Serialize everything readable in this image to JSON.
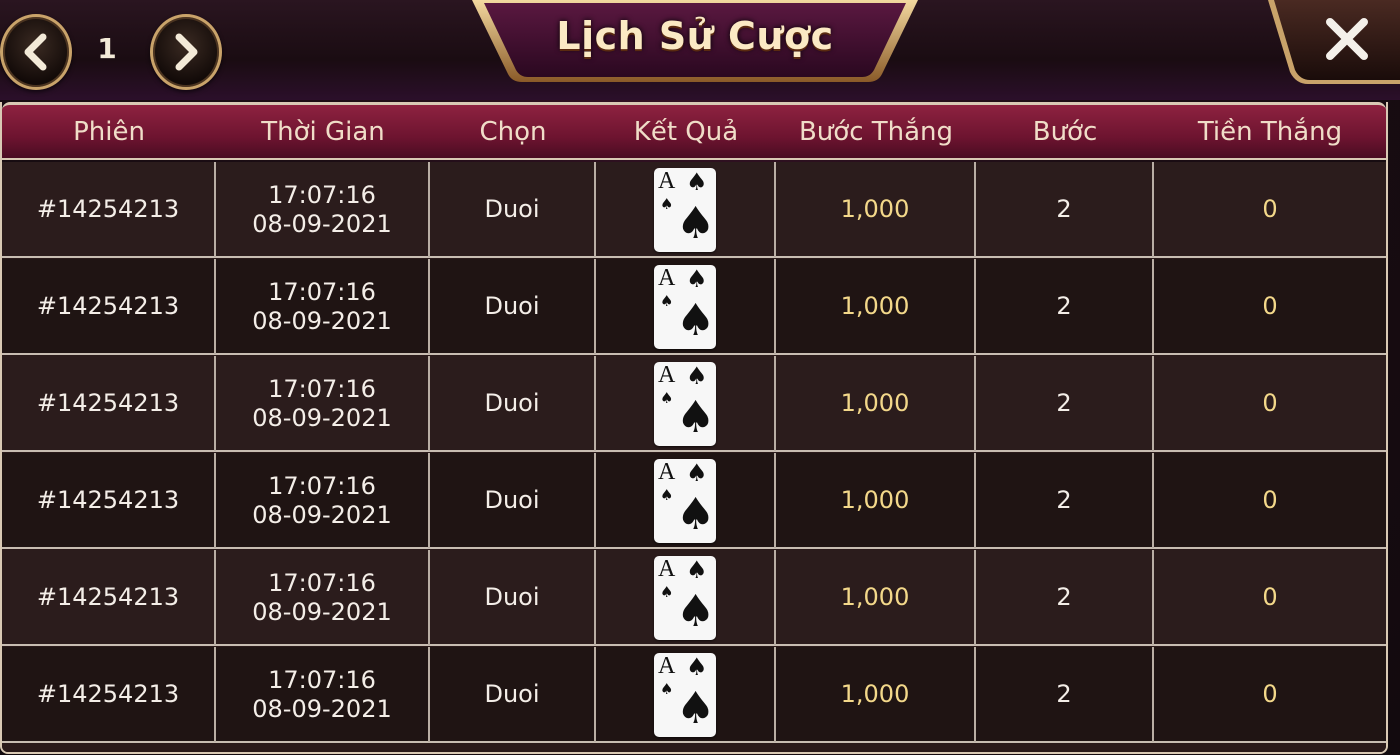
{
  "header": {
    "title": "Lịch Sử Cược",
    "page": "1"
  },
  "table": {
    "columns": [
      "Phiên",
      "Thời Gian",
      "Chọn",
      "Kết Quả",
      "Bước Thắng",
      "Bước",
      "Tiền Thắng"
    ],
    "rows": [
      {
        "session": "#14254213",
        "time": "17:07:16",
        "date": "08-09-2021",
        "choice": "Duoi",
        "card_rank": "A",
        "card_suit": "♠",
        "win_step": "1,000",
        "step": "2",
        "winnings": "0"
      },
      {
        "session": "#14254213",
        "time": "17:07:16",
        "date": "08-09-2021",
        "choice": "Duoi",
        "card_rank": "A",
        "card_suit": "♠",
        "win_step": "1,000",
        "step": "2",
        "winnings": "0"
      },
      {
        "session": "#14254213",
        "time": "17:07:16",
        "date": "08-09-2021",
        "choice": "Duoi",
        "card_rank": "A",
        "card_suit": "♠",
        "win_step": "1,000",
        "step": "2",
        "winnings": "0"
      },
      {
        "session": "#14254213",
        "time": "17:07:16",
        "date": "08-09-2021",
        "choice": "Duoi",
        "card_rank": "A",
        "card_suit": "♠",
        "win_step": "1,000",
        "step": "2",
        "winnings": "0"
      },
      {
        "session": "#14254213",
        "time": "17:07:16",
        "date": "08-09-2021",
        "choice": "Duoi",
        "card_rank": "A",
        "card_suit": "♠",
        "win_step": "1,000",
        "step": "2",
        "winnings": "0"
      },
      {
        "session": "#14254213",
        "time": "17:07:16",
        "date": "08-09-2021",
        "choice": "Duoi",
        "card_rank": "A",
        "card_suit": "♠",
        "win_step": "1,000",
        "step": "2",
        "winnings": "0"
      }
    ]
  },
  "icons": {
    "prev": "chevron-left-icon",
    "next": "chevron-right-icon",
    "close": "close-icon"
  },
  "colors": {
    "gold_text": "#f3d88a",
    "header_bar": "#7a1836",
    "frame_gold": "#c9a36a"
  }
}
